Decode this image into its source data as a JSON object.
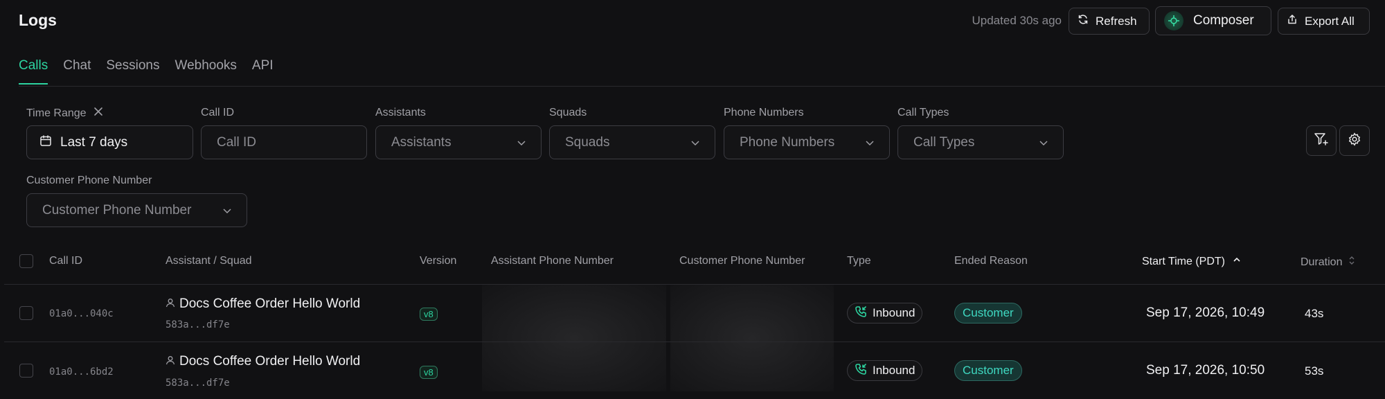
{
  "header": {
    "title": "Logs",
    "updated": "Updated 30s ago",
    "refresh_label": "Refresh",
    "composer_label": "Composer",
    "export_label": "Export All"
  },
  "tabs": [
    {
      "label": "Calls",
      "active": true
    },
    {
      "label": "Chat",
      "active": false
    },
    {
      "label": "Sessions",
      "active": false
    },
    {
      "label": "Webhooks",
      "active": false
    },
    {
      "label": "API",
      "active": false
    }
  ],
  "filters": {
    "time_range": {
      "label": "Time Range",
      "value": "Last 7 days"
    },
    "call_id": {
      "label": "Call ID",
      "placeholder": "Call ID"
    },
    "assistants": {
      "label": "Assistants",
      "placeholder": "Assistants"
    },
    "squads": {
      "label": "Squads",
      "placeholder": "Squads"
    },
    "phone_numbers": {
      "label": "Phone Numbers",
      "placeholder": "Phone Numbers"
    },
    "call_types": {
      "label": "Call Types",
      "placeholder": "Call Types"
    },
    "customer_phone": {
      "label": "Customer Phone Number",
      "placeholder": "Customer Phone Number"
    }
  },
  "table": {
    "columns": {
      "call_id": "Call ID",
      "assistant": "Assistant / Squad",
      "version": "Version",
      "assistant_phone": "Assistant Phone Number",
      "customer_phone": "Customer Phone Number",
      "type": "Type",
      "ended_reason": "Ended Reason",
      "start_time": "Start Time (PDT)",
      "duration": "Duration"
    },
    "rows": [
      {
        "call_id": "01a0...040c",
        "assistant_name": "Docs Coffee Order Hello World",
        "assistant_id": "583a...df7e",
        "version": "v8",
        "type": "Inbound",
        "ended_reason": "Customer",
        "start_time": "Sep 17, 2026, 10:49",
        "duration": "43s"
      },
      {
        "call_id": "01a0...6bd2",
        "assistant_name": "Docs Coffee Order Hello World",
        "assistant_id": "583a...df7e",
        "version": "v8",
        "type": "Inbound",
        "ended_reason": "Customer",
        "start_time": "Sep 17, 2026, 10:50",
        "duration": "53s"
      }
    ]
  },
  "colors": {
    "accent": "#2dd4a0",
    "background": "#111113",
    "reason_pill": "#3fd9c2"
  }
}
